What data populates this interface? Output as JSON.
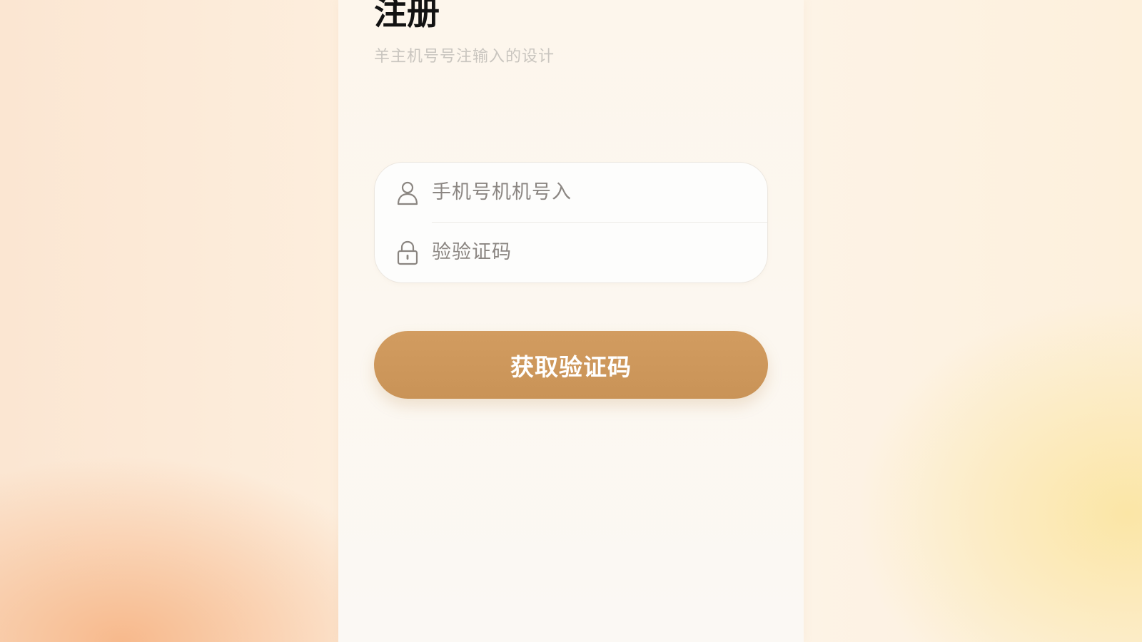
{
  "page": {
    "title": "注册",
    "subtitle": "羊主机号号注输入的设计"
  },
  "form": {
    "phone_field": {
      "placeholder": "手机号机机号入",
      "icon": "user-icon"
    },
    "code_field": {
      "placeholder": "验验证码",
      "icon": "lock-icon"
    }
  },
  "actions": {
    "get_code_label": "获取验证码"
  },
  "colors": {
    "accent": "#cf995c",
    "title": "#121212",
    "placeholder": "#8b8682",
    "subtitle": "#c9c5bf"
  }
}
